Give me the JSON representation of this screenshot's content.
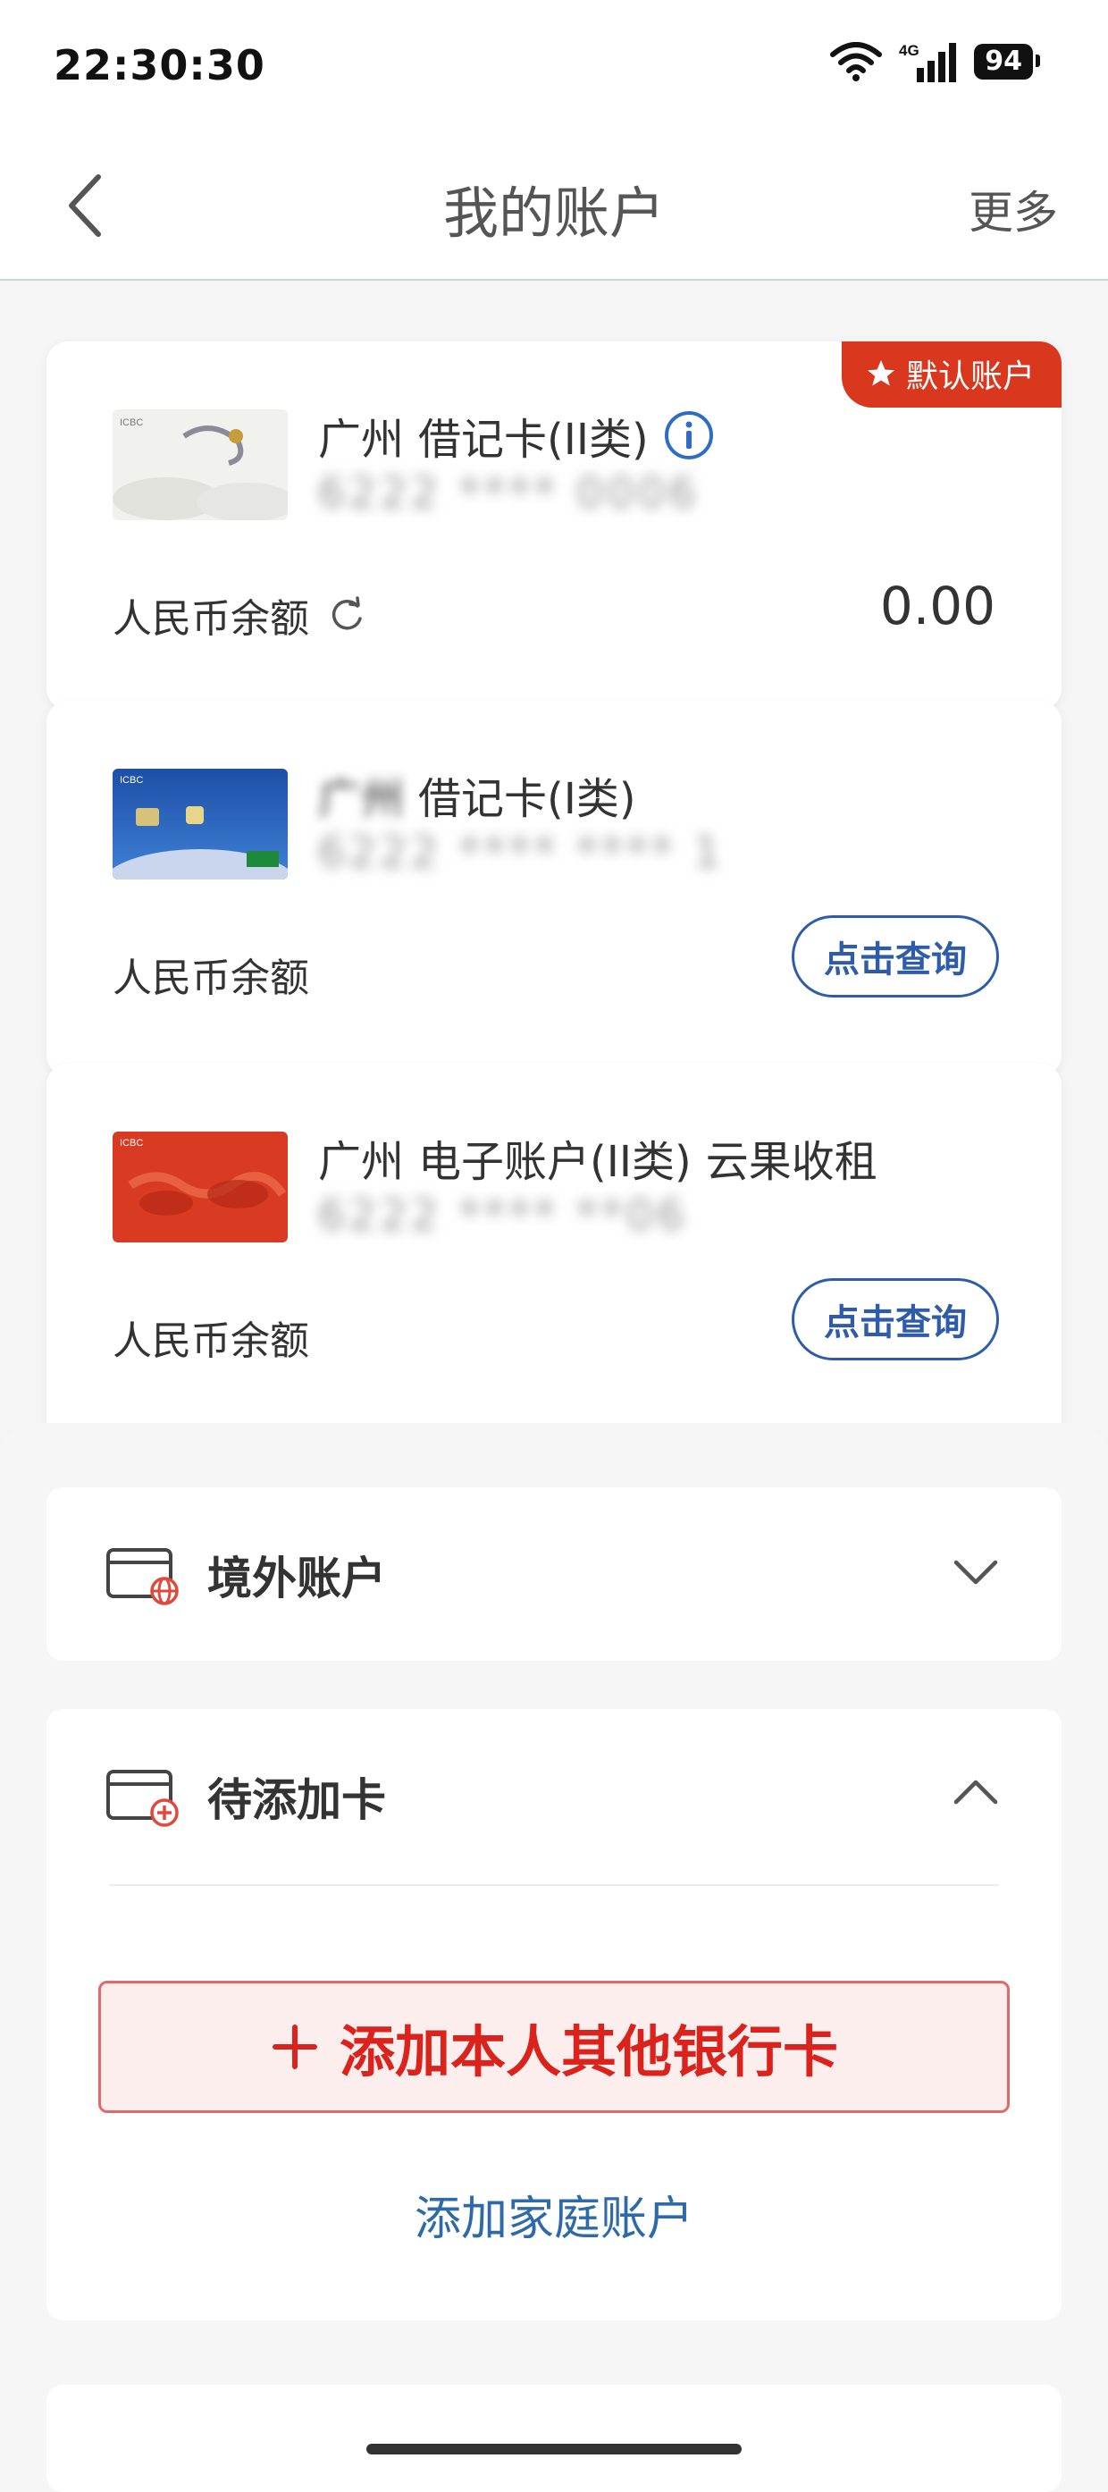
{
  "status_bar": {
    "time": "22:30:30",
    "network": "4G",
    "battery": "94"
  },
  "nav": {
    "title": "我的账户",
    "more": "更多"
  },
  "accounts": [
    {
      "region": "广州",
      "type": "借记卡(II类)",
      "number_masked": "6222 **** 0006",
      "balance_label": "人民币余额",
      "balance": "0.00",
      "default_tag": "默认账户",
      "card_style": "dragon"
    },
    {
      "region": "广州",
      "type": "借记卡(I类)",
      "number_masked": "6222 **** **** 1",
      "balance_label": "人民币余额",
      "query_label": "点击查询",
      "card_style": "blue"
    },
    {
      "region": "广州",
      "type": "电子账户(II类)",
      "suffix": "云果收租",
      "number_masked": "6222 **** **06",
      "balance_label": "人民币余额",
      "query_label": "点击查询",
      "card_style": "red"
    }
  ],
  "abroad_section": {
    "title": "境外账户"
  },
  "pending_section": {
    "title": "待添加卡",
    "add_other_card": "添加本人其他银行卡",
    "add_family": "添加家庭账户"
  },
  "colors": {
    "accent_red": "#d9381e",
    "link_blue": "#2f5ca8",
    "family_link": "#2f6aa8"
  }
}
